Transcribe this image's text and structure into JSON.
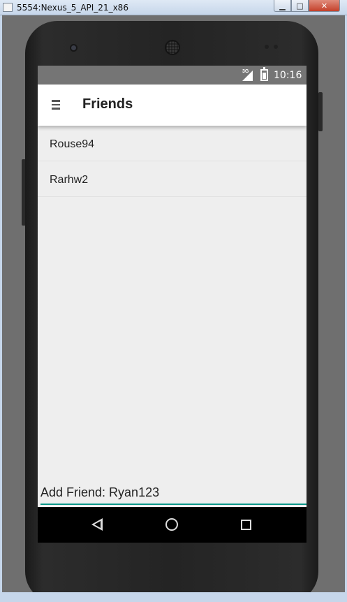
{
  "window": {
    "title": "5554:Nexus_5_API_21_x86",
    "minimize_glyph": "▁",
    "maximize_glyph": "□",
    "close_glyph": "✕"
  },
  "status_bar": {
    "network": "3G",
    "time": "10:16",
    "icons": [
      "signal-icon",
      "battery-icon"
    ]
  },
  "toolbar": {
    "menu_icon": "hamburger-menu-icon",
    "title": "Friends"
  },
  "friends": [
    {
      "name": "Rouse94"
    },
    {
      "name": "Rarhw2"
    }
  ],
  "add_friend": {
    "value": "Add Friend: Ryan123"
  },
  "nav_bar": {
    "icons": [
      "back-icon",
      "home-icon",
      "recents-icon"
    ]
  },
  "colors": {
    "accent": "#009688",
    "status_bar": "#757575",
    "toolbar": "#ffffff",
    "background": "#eeeeee"
  }
}
